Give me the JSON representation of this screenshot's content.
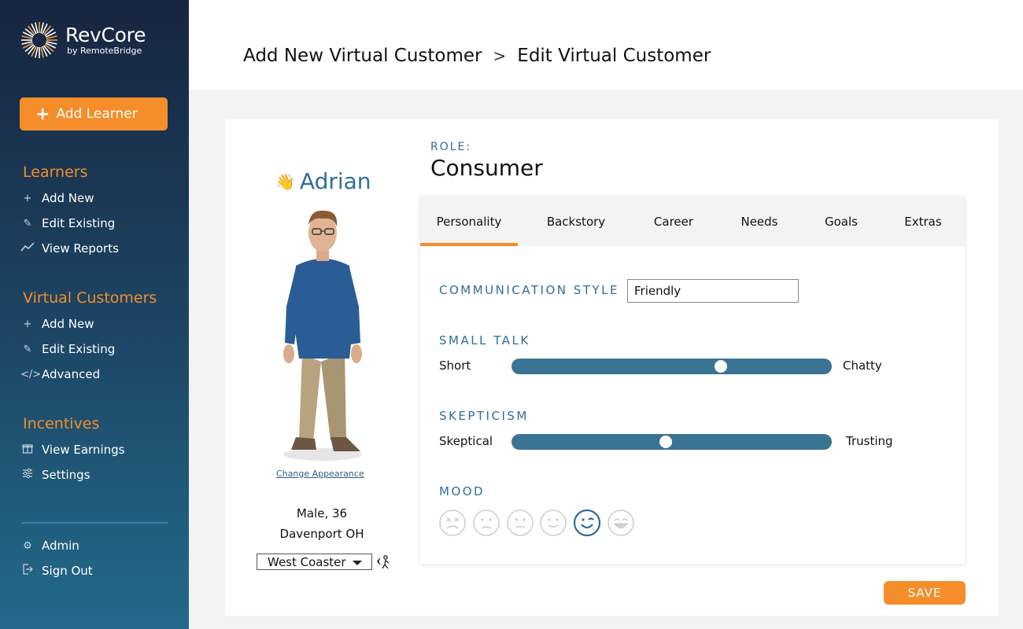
{
  "brand": {
    "name": "RevCore",
    "sub": "by RemoteBridge"
  },
  "sidebar": {
    "add_learner": "Add Learner",
    "sections": [
      {
        "heading": "Learners",
        "items": [
          {
            "label": "Add New",
            "icon": "plus-icon"
          },
          {
            "label": "Edit Existing",
            "icon": "pencil-icon"
          },
          {
            "label": "View Reports",
            "icon": "chart-line-icon"
          }
        ]
      },
      {
        "heading": "Virtual Customers",
        "items": [
          {
            "label": "Add New",
            "icon": "plus-icon"
          },
          {
            "label": "Edit Existing",
            "icon": "pencil-icon"
          },
          {
            "label": "Advanced",
            "icon": "code-icon"
          }
        ]
      },
      {
        "heading": "Incentives",
        "items": [
          {
            "label": "View Earnings",
            "icon": "gift-icon"
          },
          {
            "label": "Settings",
            "icon": "sliders-icon"
          }
        ]
      }
    ],
    "footer": [
      {
        "label": "Admin",
        "icon": "gear-icon"
      },
      {
        "label": "Sign Out",
        "icon": "sign-out-icon"
      }
    ]
  },
  "breadcrumb": {
    "parent": "Add New Virtual Customer",
    "separator": ">",
    "current": "Edit Virtual Customer"
  },
  "character": {
    "name": "Adrian",
    "change_appearance": "Change Appearance",
    "demographics": "Male, 36",
    "location": "Davenport OH",
    "accent": "West Coaster"
  },
  "role": {
    "label": "ROLE:",
    "value": "Consumer"
  },
  "tabs": [
    "Personality",
    "Backstory",
    "Career",
    "Needs",
    "Goals",
    "Extras"
  ],
  "active_tab": "Personality",
  "personality": {
    "communication_style_label": "COMMUNICATION STYLE",
    "communication_style": "Friendly",
    "small_talk": {
      "label": "SMALL TALK",
      "min": "Short",
      "max": "Chatty",
      "value": 0.66
    },
    "skepticism": {
      "label": "SKEPTICISM",
      "min": "Skeptical",
      "max": "Trusting",
      "value": 0.48
    },
    "mood": {
      "label": "MOOD",
      "options": [
        "very-sad",
        "sad",
        "neutral",
        "content",
        "happy",
        "very-happy"
      ],
      "selected": 4
    }
  },
  "save_label": "SAVE",
  "colors": {
    "accent": "#f58e2a",
    "primary": "#2f6f96",
    "track": "#3a7493"
  }
}
